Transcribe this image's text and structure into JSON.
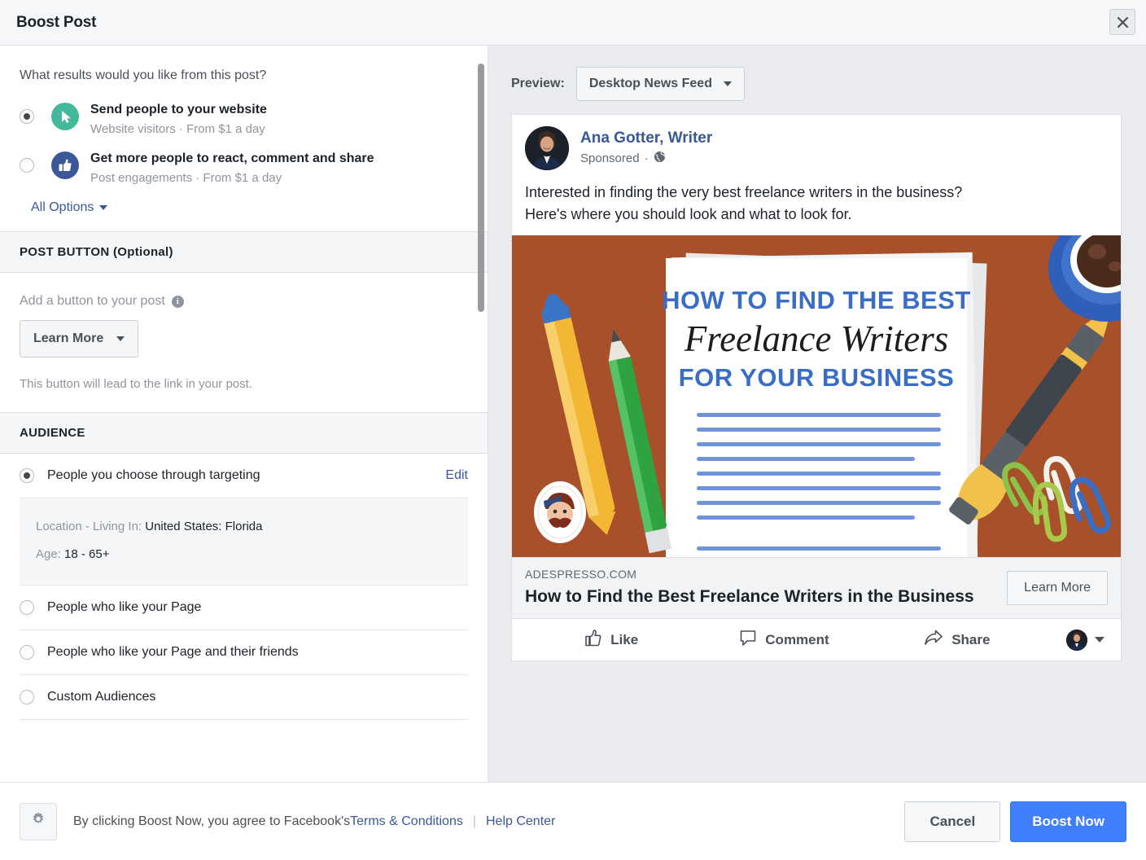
{
  "dialog": {
    "title": "Boost Post",
    "close_icon": "close-icon"
  },
  "form": {
    "question": "What results would you like from this post?",
    "goals": [
      {
        "icon": "cursor-arrow-icon",
        "icon_color": "#42b99a",
        "title": "Send people to your website",
        "subtitle": "Website visitors · From $1 a day",
        "selected": true
      },
      {
        "icon": "thumbs-up-icon",
        "icon_color": "#3b5998",
        "title": "Get more people to react, comment and share",
        "subtitle": "Post engagements · From $1 a day",
        "selected": false
      }
    ],
    "all_options_label": "All Options",
    "post_button_section": {
      "header": "POST BUTTON (Optional)",
      "field_label": "Add a button to your post",
      "info_icon": "info-icon",
      "selected_value": "Learn More",
      "helper_text": "This button will lead to the link in your post."
    },
    "audience_section": {
      "header": "AUDIENCE",
      "options": [
        {
          "label": "People you choose through targeting",
          "selected": true,
          "edit_label": "Edit"
        },
        {
          "label": "People who like your Page",
          "selected": false
        },
        {
          "label": "People who like your Page and their friends",
          "selected": false
        },
        {
          "label": "Custom Audiences",
          "selected": false
        }
      ],
      "targeting_details": [
        {
          "key": "Location - Living In:",
          "value": "United States: Florida"
        },
        {
          "key": "Age:",
          "value": "18 - 65+"
        }
      ]
    }
  },
  "preview": {
    "label": "Preview:",
    "placement": "Desktop News Feed",
    "post": {
      "page_name": "Ana Gotter, Writer",
      "sponsored_label": "Sponsored",
      "privacy_icon": "globe-icon",
      "separator": "·",
      "body_line_1": "Interested in finding the very best freelance writers in the business?",
      "body_line_2": "Here's where you should look and what to look for.",
      "creative": {
        "headline_top": "HOW TO FIND THE BEST",
        "headline_script": "Freelance Writers",
        "headline_bottom": "FOR YOUR BUSINESS",
        "background_color": "#a8502a",
        "accent_color": "#3a6dc4"
      },
      "link_domain": "ADESPRESSO.COM",
      "link_title": "How to Find the Best Freelance Writers in the Business",
      "cta_label": "Learn More",
      "actions": [
        {
          "label": "Like",
          "icon": "thumbs-up-outline-icon"
        },
        {
          "label": "Comment",
          "icon": "comment-bubble-icon"
        },
        {
          "label": "Share",
          "icon": "share-arrow-icon"
        }
      ],
      "actor_selector_icon": "avatar-caret-icon"
    }
  },
  "footer": {
    "gear_icon": "gear-icon",
    "legal_prefix": "By clicking Boost Now, you agree to Facebook's ",
    "terms_link": "Terms & Conditions",
    "separator": "|",
    "help_link": "Help Center",
    "cancel_label": "Cancel",
    "boost_label": "Boost Now"
  }
}
